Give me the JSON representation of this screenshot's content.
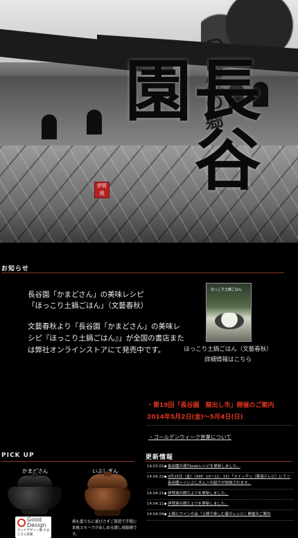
{
  "hero": {
    "subtitle": "つぼ焼の郷",
    "logo": "長谷園",
    "seal": "伊賀焼"
  },
  "notice": {
    "section_title": "お知らせ",
    "line1": "長谷園「かまどさん」の美味レシピ",
    "line2": "「ほっこり土鍋ごはん」（文藝春秋）",
    "body": "文藝春秋より「長谷園「かまどさん」の美味レシピ『ほっこり土鍋ごはん』」が全国の書店または弊社オンラインストアにて発売中です。",
    "book_cover_title": "ほっこり土鍋ごはん",
    "book_caption_1": "ほっこり土鍋ごはん（文藝春秋）",
    "book_caption_2": "詳細情報はこちら"
  },
  "event": {
    "title": "・第19回「長谷園　窯出し市」開催のご案内",
    "dates": "2014年5月2日(金)〜5月4日(日)",
    "gw_link": "・ゴールデンウィーク営業について"
  },
  "pickup": {
    "section_title": "PICK UP",
    "item1_label": "かまどさん",
    "item2_label": "いぶしぎん",
    "item2_desc": "焼も香りもに遊びさずご家庭で手軽に本格スモークがあしめる燻し焼製鍋です。",
    "badge_line1": "Good",
    "badge_line2": "Design",
    "badge_line3": "グッドデザイン賞 かまどさん受賞"
  },
  "updates": {
    "section_title": "更新情報",
    "items": [
      {
        "date": "14.03.02◆",
        "text": "長谷園の週刊webレシピを更新しました。"
      },
      {
        "date": "14.04.22◆",
        "text": "4月25日（金）（AM）10〜11：15）「スイッチ!」（東海テレビ）にて＜長谷園＞＜いぶしぎん＞の紹介が放映されます。"
      },
      {
        "date": "14.04.21◆",
        "text": "伊賀焼の館だよりを更新しました。"
      },
      {
        "date": "14.04.11◆",
        "text": "伊賀焼の館だよりを更新しました。"
      },
      {
        "date": "14.04.04◆",
        "text": "土鍋とワインの会『土鍋で楽しむ春のレシピ』開催のご案内"
      }
    ]
  }
}
